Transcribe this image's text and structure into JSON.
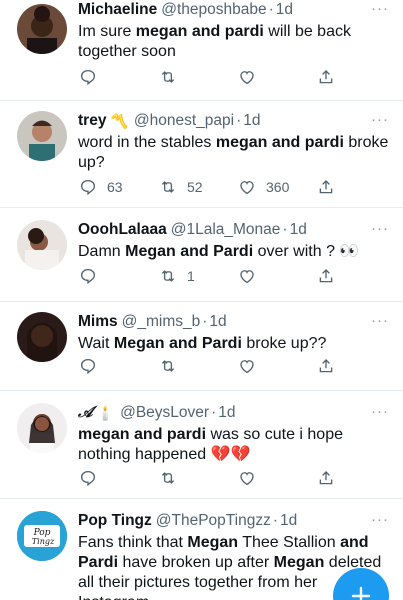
{
  "tweets": [
    {
      "name": "Michaeline",
      "emoji": "",
      "handle": "@theposhbabe",
      "time": "1d",
      "text_parts": [
        {
          "t": "Im sure ",
          "b": false
        },
        {
          "t": "megan and pardi",
          "b": true
        },
        {
          "t": " will be back together soon",
          "b": false
        }
      ],
      "replies": "",
      "retweets": "",
      "likes": ""
    },
    {
      "name": "trey",
      "emoji": "〽️",
      "handle": "@honest_papi",
      "time": "1d",
      "text_parts": [
        {
          "t": "word in the stables ",
          "b": false
        },
        {
          "t": "megan and pardi",
          "b": true
        },
        {
          "t": " broke up?",
          "b": false
        }
      ],
      "replies": "63",
      "retweets": "52",
      "likes": "360"
    },
    {
      "name": "OoohLalaaa",
      "emoji": "",
      "handle": "@1Lala_Monae",
      "time": "1d",
      "text_parts": [
        {
          "t": "Damn ",
          "b": false
        },
        {
          "t": "Megan and Pardi",
          "b": true
        },
        {
          "t": " over with ? 👀",
          "b": false
        }
      ],
      "replies": "",
      "retweets": "1",
      "likes": ""
    },
    {
      "name": "Mims",
      "emoji": "",
      "handle": "@_mims_b",
      "time": "1d",
      "text_parts": [
        {
          "t": "Wait ",
          "b": false
        },
        {
          "t": "Megan and Pardi",
          "b": true
        },
        {
          "t": " broke up??",
          "b": false
        }
      ],
      "replies": "",
      "retweets": "",
      "likes": ""
    },
    {
      "name": "𝒜",
      "emoji": "🕯️",
      "handle": "@BeysLover",
      "time": "1d",
      "text_parts": [
        {
          "t": "megan and pardi",
          "b": true
        },
        {
          "t": " was so cute i hope nothing happened 💔💔",
          "b": false
        }
      ],
      "replies": "",
      "retweets": "",
      "likes": ""
    },
    {
      "name": "Pop Tingz",
      "emoji": "",
      "handle": "@ThePopTingzz",
      "time": "1d",
      "text_parts": [
        {
          "t": "Fans think that ",
          "b": false
        },
        {
          "t": "Megan",
          "b": true
        },
        {
          "t": " Thee Stallion ",
          "b": false
        },
        {
          "t": "and Pardi",
          "b": true
        },
        {
          "t": " have broken up after ",
          "b": false
        },
        {
          "t": "Megan",
          "b": true
        },
        {
          "t": " deleted all their pictures together from her Instagram.",
          "b": false
        }
      ],
      "replies": "",
      "retweets": "",
      "likes": ""
    }
  ],
  "avatar_logo_text": [
    "Pop",
    "Tingz"
  ],
  "more_glyph": "···",
  "dot": "·",
  "fab_icon": "compose-plus-icon",
  "colors": {
    "accent": "#1d9bf0",
    "muted": "#536471",
    "divider": "#e6ecf0"
  }
}
